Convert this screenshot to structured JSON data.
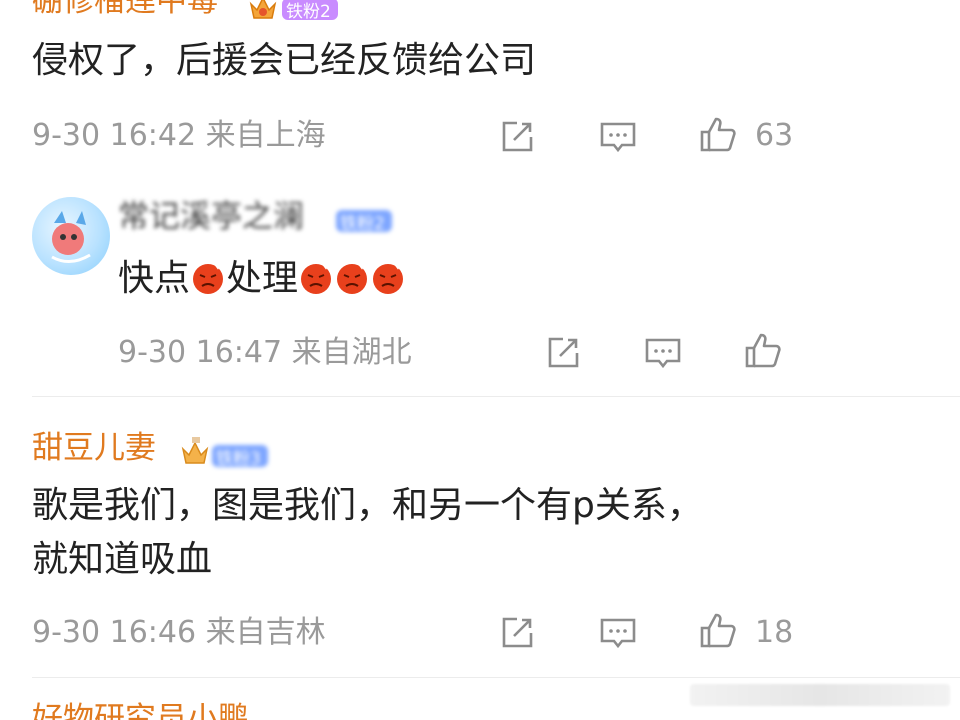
{
  "comments": [
    {
      "username": "硼修榴莲中毒",
      "badge": "铁粉2",
      "content": "侵权了，后援会已经反馈给公司",
      "meta": "9-30 16:42 来自上海",
      "likes": "63"
    },
    {
      "username": "常记溪亭之澜",
      "badge": "铁粉2",
      "content_parts": [
        "快点",
        "处理"
      ],
      "meta": "9-30 16:47 来自湖北",
      "likes": ""
    },
    {
      "username": "甜豆儿妻",
      "badge": "铁粉3",
      "content_line1": "歌是我们，图是我们，和另一个有p关系，",
      "content_line2": "就知道吸血",
      "meta": "9-30 16:46 来自吉林",
      "likes": "18"
    },
    {
      "username": "好物研究员小鹏"
    }
  ],
  "icons": {
    "repost": "share-icon",
    "comment": "comment-icon",
    "like": "thumbs-up-icon"
  },
  "colors": {
    "username": "#e07a1f",
    "meta": "#9a9a9a",
    "text": "#222222",
    "badge": "#7ea6ff",
    "angry_emoji": "#e8401c"
  }
}
